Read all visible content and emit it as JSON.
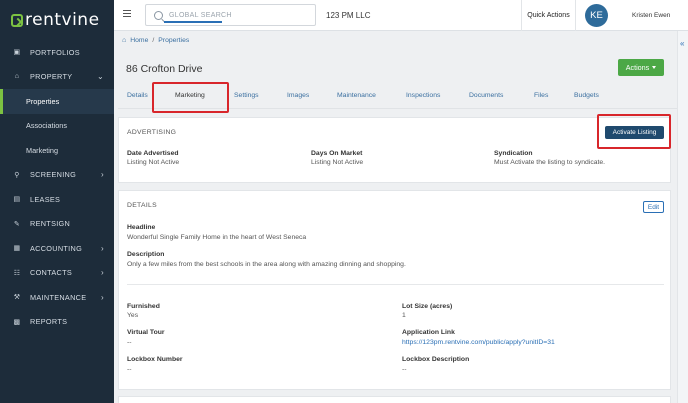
{
  "app": {
    "logo_text": "rentvine"
  },
  "sidebar": {
    "items": [
      {
        "label": "PORTFOLIOS",
        "icon": "folder-icon"
      },
      {
        "label": "PROPERTY",
        "icon": "home-icon",
        "expanded": true
      },
      {
        "label": "Properties",
        "sub": true,
        "active": true
      },
      {
        "label": "Associations",
        "sub": true
      },
      {
        "label": "Marketing",
        "sub": true
      },
      {
        "label": "SCREENING",
        "icon": "magnifier-icon"
      },
      {
        "label": "LEASES",
        "icon": "document-icon"
      },
      {
        "label": "RENTSIGN",
        "icon": "pen-icon"
      },
      {
        "label": "ACCOUNTING",
        "icon": "calculator-icon"
      },
      {
        "label": "CONTACTS",
        "icon": "contacts-icon"
      },
      {
        "label": "MAINTENANCE",
        "icon": "wrench-icon"
      },
      {
        "label": "REPORTS",
        "icon": "reports-icon"
      }
    ]
  },
  "topbar": {
    "search_placeholder": "GLOBAL SEARCH",
    "company": "123 PM LLC",
    "quick_actions": "Quick Actions",
    "avatar_initials": "KE",
    "user_name": "Kristen Ewen"
  },
  "breadcrumb": {
    "home": "Home",
    "separator": "/",
    "current": "Properties"
  },
  "page": {
    "title": "86 Crofton Drive",
    "actions_label": "Actions"
  },
  "tabs": [
    {
      "label": "Details"
    },
    {
      "label": "Marketing",
      "active": true
    },
    {
      "label": "Settings"
    },
    {
      "label": "Images"
    },
    {
      "label": "Maintenance"
    },
    {
      "label": "Inspections"
    },
    {
      "label": "Documents"
    },
    {
      "label": "Files"
    },
    {
      "label": "Budgets"
    }
  ],
  "advertising": {
    "title": "ADVERTISING",
    "activate_label": "Activate Listing",
    "date_advertised_label": "Date Advertised",
    "date_advertised_value": "Listing Not Active",
    "days_on_market_label": "Days On Market",
    "days_on_market_value": "Listing Not Active",
    "syndication_label": "Syndication",
    "syndication_value": "Must Activate the listing to syndicate."
  },
  "details": {
    "title": "DETAILS",
    "edit_label": "Edit",
    "headline_label": "Headline",
    "headline_value": "Wonderful Single Family Home in the heart of West Seneca",
    "description_label": "Description",
    "description_value": "Only a few miles from the best schools in the area along with amazing dinning and shopping.",
    "furnished_label": "Furnished",
    "furnished_value": "Yes",
    "lot_size_label": "Lot Size (acres)",
    "lot_size_value": "1",
    "virtual_tour_label": "Virtual Tour",
    "virtual_tour_value": "--",
    "application_link_label": "Application Link",
    "application_link_value": "https://123pm.rentvine.com/public/apply?unitID=31",
    "lockbox_number_label": "Lockbox Number",
    "lockbox_number_value": "--",
    "lockbox_description_label": "Lockbox Description",
    "lockbox_description_value": "--"
  },
  "colors": {
    "sidebar_bg": "#1d2c3a",
    "accent_green": "#4ca846",
    "link_blue": "#2a6fb5",
    "activate_btn": "#1f4a6e",
    "highlight_red": "#d8262b"
  }
}
